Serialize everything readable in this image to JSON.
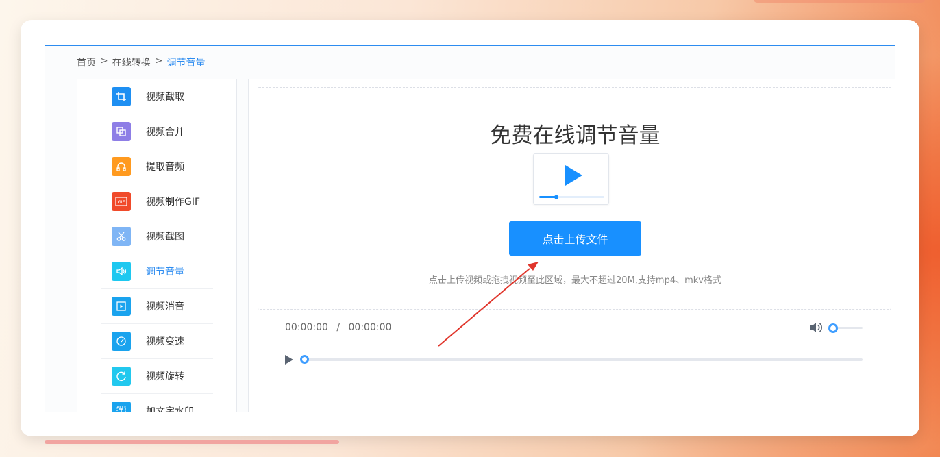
{
  "breadcrumb": {
    "home": "首页",
    "sep1": ">",
    "category": "在线转换",
    "sep2": ">",
    "current": "调节音量"
  },
  "sidebar": {
    "items": [
      {
        "label": "视频截取",
        "icon": "crop-icon",
        "color": "#1e8ff2"
      },
      {
        "label": "视频合并",
        "icon": "merge-icon",
        "color": "#8e7ee6"
      },
      {
        "label": "提取音频",
        "icon": "headphones-icon",
        "color": "#ff9a1f"
      },
      {
        "label": "视频制作GIF",
        "icon": "gif-icon",
        "color": "#f04a2a"
      },
      {
        "label": "视频截图",
        "icon": "scissors-icon",
        "color": "#7fb5f5"
      },
      {
        "label": "调节音量",
        "icon": "volume-icon",
        "color": "#1ec8f0",
        "active": true
      },
      {
        "label": "视频消音",
        "icon": "play-box-icon",
        "color": "#1aa3ee"
      },
      {
        "label": "视频变速",
        "icon": "speedometer-icon",
        "color": "#1aa3ee"
      },
      {
        "label": "视频旋转",
        "icon": "rotate-icon",
        "color": "#22c8ee"
      },
      {
        "label": "加文字水印",
        "icon": "text-watermark-icon",
        "color": "#1aa3ee"
      }
    ]
  },
  "main": {
    "title": "免费在线调节音量",
    "upload_button": "点击上传文件",
    "hint": "点击上传视频或拖拽视频至此区域，最大不超过20M,支持mp4、mkv格式"
  },
  "player": {
    "current_time": "00:00:00",
    "separator": "/",
    "duration": "00:00:00",
    "volume_level": 0,
    "progress": 0
  },
  "colors": {
    "accent": "#2d8cf0",
    "button": "#1890ff",
    "annotation_arrow": "#e0352b"
  }
}
